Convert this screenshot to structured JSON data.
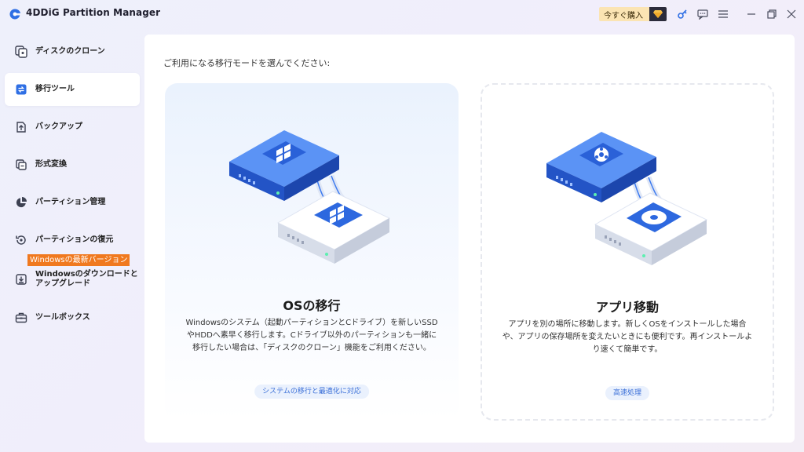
{
  "app": {
    "title": "4DDiG Partition Manager",
    "buy_label": "今すぐ購入",
    "accent": "#2f6fe4",
    "badge_color": "#f0791f"
  },
  "titlebar_icons": [
    "diamond-icon",
    "key-icon",
    "feedback-icon",
    "menu-icon",
    "minimize-icon",
    "restore-icon",
    "close-icon"
  ],
  "sidebar": {
    "items": [
      {
        "label": "ディスクのクローン",
        "icon": "disk-clone-icon"
      },
      {
        "label": "移行ツール",
        "icon": "migrate-icon",
        "active": true
      },
      {
        "label": "バックアップ",
        "icon": "backup-icon"
      },
      {
        "label": "形式変換",
        "icon": "convert-icon"
      },
      {
        "label": "パーティション管理",
        "icon": "partition-icon"
      },
      {
        "label": "パーティションの復元",
        "icon": "restore-partition-icon"
      },
      {
        "label": "Windowsのダウンロードと",
        "label2": "アップグレード",
        "icon": "download-icon"
      },
      {
        "label": "ツールボックス",
        "icon": "toolbox-icon"
      }
    ],
    "new_badge": "Windowsの最新バージョン"
  },
  "main": {
    "prompt": "ご利用になる移行モードを選んでください:",
    "cards": [
      {
        "title": "OSの移行",
        "desc": "Windowsのシステム（起動パーティションとCドライブ）を新しいSSDやHDDへ素早く移行します。Cドライブ以外のパーティションも一緒に移行したい場合は、「ディスクのクローン」機能をご利用ください。",
        "tag": "システムの移行と最適化に対応"
      },
      {
        "title": "アプリ移動",
        "desc": "アプリを別の場所に移動します。新しくOSをインストールした場合や、アプリの保存場所を変えたいときにも便利です。再インストールより速くて簡単です。",
        "tag": "高速処理"
      }
    ]
  }
}
